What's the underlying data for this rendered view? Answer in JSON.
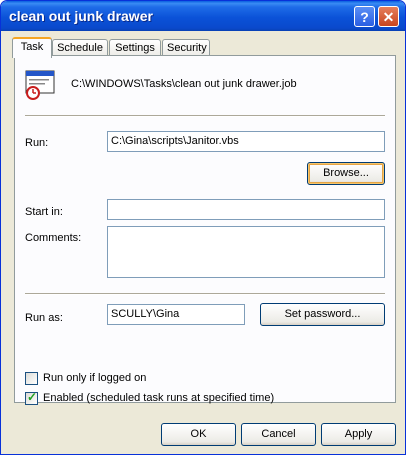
{
  "window": {
    "title": "clean out junk drawer",
    "help_label": "?",
    "close_label": "✕"
  },
  "tabs": [
    {
      "label": "Task",
      "active": true
    },
    {
      "label": "Schedule",
      "active": false
    },
    {
      "label": "Settings",
      "active": false
    },
    {
      "label": "Security",
      "active": false
    }
  ],
  "task": {
    "icon": "scheduled-task-icon",
    "path": "C:\\WINDOWS\\Tasks\\clean out junk drawer.job",
    "run_label": "Run:",
    "run_value": "C:\\Gina\\scripts\\Janitor.vbs",
    "browse_label": "Browse...",
    "start_in_label": "Start in:",
    "start_in_value": "",
    "comments_label": "Comments:",
    "comments_value": "",
    "run_as_label": "Run as:",
    "run_as_value": "SCULLY\\Gina",
    "set_password_label": "Set password...",
    "run_only_logged_on_label": "Run only if logged on",
    "run_only_logged_on_checked": false,
    "enabled_label": "Enabled (scheduled task runs at specified time)",
    "enabled_checked": true
  },
  "footer": {
    "ok_label": "OK",
    "cancel_label": "Cancel",
    "apply_label": "Apply"
  },
  "colors": {
    "titlebar": "#0a54d8",
    "dialog_bg": "#ece9d8",
    "default_button_glow": "#f5c66e"
  }
}
